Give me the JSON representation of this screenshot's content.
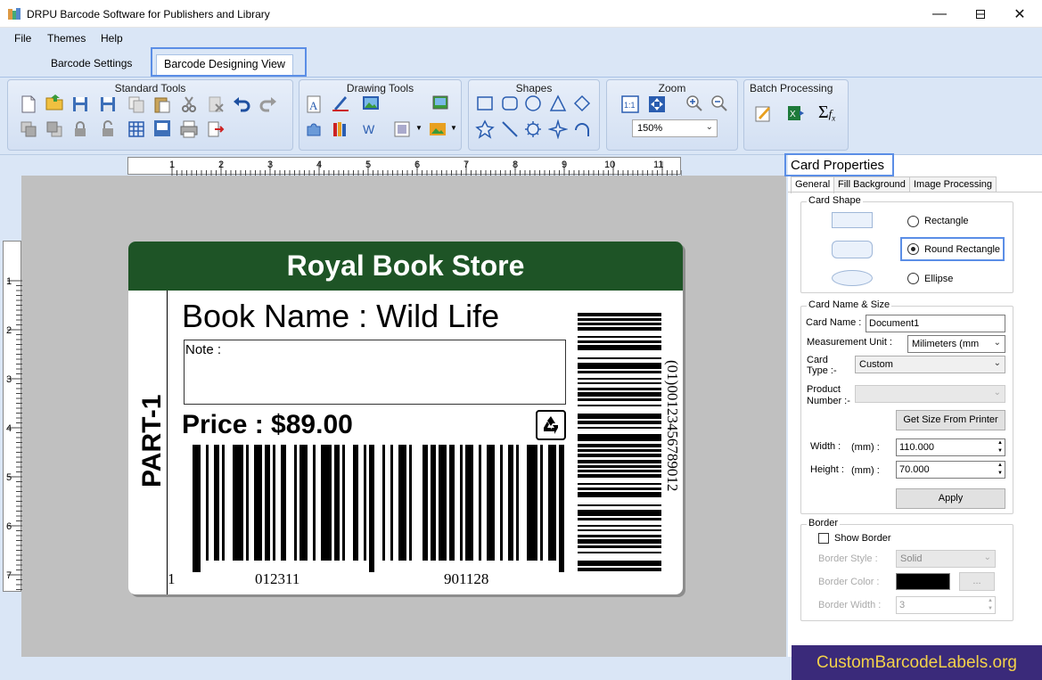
{
  "window": {
    "title": "DRPU Barcode Software for Publishers and Library"
  },
  "menu": [
    "File",
    "Themes",
    "Help"
  ],
  "tabs": [
    {
      "label": "Barcode Settings"
    },
    {
      "label": "Barcode Designing View"
    }
  ],
  "ribbon": {
    "groups": [
      "Standard Tools",
      "Drawing Tools",
      "Shapes",
      "Zoom",
      "Batch Processing"
    ],
    "zoom_value": "150%"
  },
  "ruler": {
    "h": [
      "1",
      "2",
      "3",
      "4",
      "5",
      "6",
      "7",
      "8",
      "9",
      "10",
      "11"
    ],
    "v": [
      "1",
      "2",
      "3",
      "4",
      "5",
      "6",
      "7"
    ]
  },
  "card": {
    "header": "Royal Book Store",
    "book_name": "Book Name : Wild Life",
    "note_label": "Note :",
    "price": "Price : $89.00",
    "part": "PART-1",
    "barcode_left_digit": "1",
    "barcode_group1": "012311",
    "barcode_group2": "901128",
    "vertical_barcode_text": "(01)00123456789012"
  },
  "panel": {
    "title": "Card Properties",
    "tabs": [
      "General",
      "Fill Background",
      "Image Processing"
    ],
    "card_shape": {
      "legend": "Card Shape",
      "options": [
        "Rectangle",
        "Round Rectangle",
        "Ellipse"
      ],
      "selected": "Round Rectangle"
    },
    "name_size": {
      "legend": "Card  Name & Size",
      "card_name_label": "Card Name :",
      "card_name": "Document1",
      "unit_label": "Measurement Unit :",
      "unit": "Milimeters (mm",
      "card_type_label1": "Card",
      "card_type_label2": "Type :-",
      "card_type": "Custom",
      "product_label1": "Product",
      "product_label2": "Number :-",
      "get_size_btn": "Get Size From Printer",
      "width_label": "Width :",
      "width_unit": "(mm) :",
      "width": "110.000",
      "height_label": "Height :",
      "height_unit": "(mm) :",
      "height": "70.000",
      "apply_btn": "Apply"
    },
    "border": {
      "legend": "Border",
      "show_border": "Show Border",
      "style_label": "Border Style :",
      "style": "Solid",
      "color_label": "Border Color :",
      "color_btn": "...",
      "width_label": "Border Width :",
      "width": "3"
    }
  },
  "watermark": "CustomBarcodeLabels.org",
  "colors": {
    "header_green": "#1e5426",
    "ribbon_bg": "#dae6f6",
    "highlight": "#5b8ee6"
  }
}
